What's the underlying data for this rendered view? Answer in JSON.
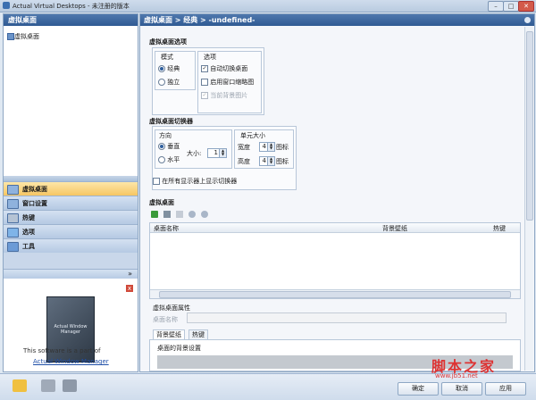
{
  "window": {
    "title": "Actual Virtual Desktops - 未注册的版本",
    "min": "–",
    "max": "□",
    "close": "✕"
  },
  "left": {
    "header": "虚拟桌面",
    "tree_item": "虚拟桌面",
    "nav": [
      {
        "label": "虚拟桌面"
      },
      {
        "label": "窗口设置"
      },
      {
        "label": "热键"
      },
      {
        "label": "选项"
      },
      {
        "label": "工具"
      }
    ],
    "more": "»",
    "promo_close": "x",
    "promo_box": "Actual Window Manager",
    "promo_text": "This software is a part of",
    "promo_link": "Actual Window Manager"
  },
  "right": {
    "header": "虚拟桌面 > 经典 > -undefined-",
    "options_title": "虚拟桌面选项",
    "mode_title": "模式",
    "mode_classic": "经典",
    "mode_independent": "独立",
    "opts_title": "选项",
    "opt_auto_switch": "自动切换桌面",
    "opt_window_thumbs": "启用窗口缩略图",
    "opt_bg_image": "当前背景图片",
    "switcher_title": "虚拟桌面切换器",
    "dir_title": "方向",
    "dir_vertical": "垂直",
    "dir_horizontal": "水平",
    "size_label": "大小:",
    "size_value": "1",
    "cell_title": "单元大小",
    "width_label": "宽度",
    "width_value": "4",
    "width_unit": "图标",
    "height_label": "高度",
    "height_value": "4",
    "height_unit": "图标",
    "all_monitors": "在所有显示器上显示切换器",
    "vd_title": "虚拟桌面",
    "col_name": "桌面名称",
    "col_bg": "背景壁纸",
    "col_hotkey": "热键",
    "props_title": "虚拟桌面属性",
    "name_label": "桌面名称",
    "tab_bg": "背景壁纸",
    "tab_hotkey": "热键",
    "bg_settings": "桌面的背景设置"
  },
  "buttons": {
    "ok": "确定",
    "cancel": "取消",
    "apply": "应用"
  },
  "watermark": {
    "main": "脚本之家",
    "sub": "www.jb51.net"
  },
  "colors": {
    "header_blue": "#2f5a93",
    "selected_nav": "#f6c663",
    "panel_bg": "#f4f6fa"
  }
}
